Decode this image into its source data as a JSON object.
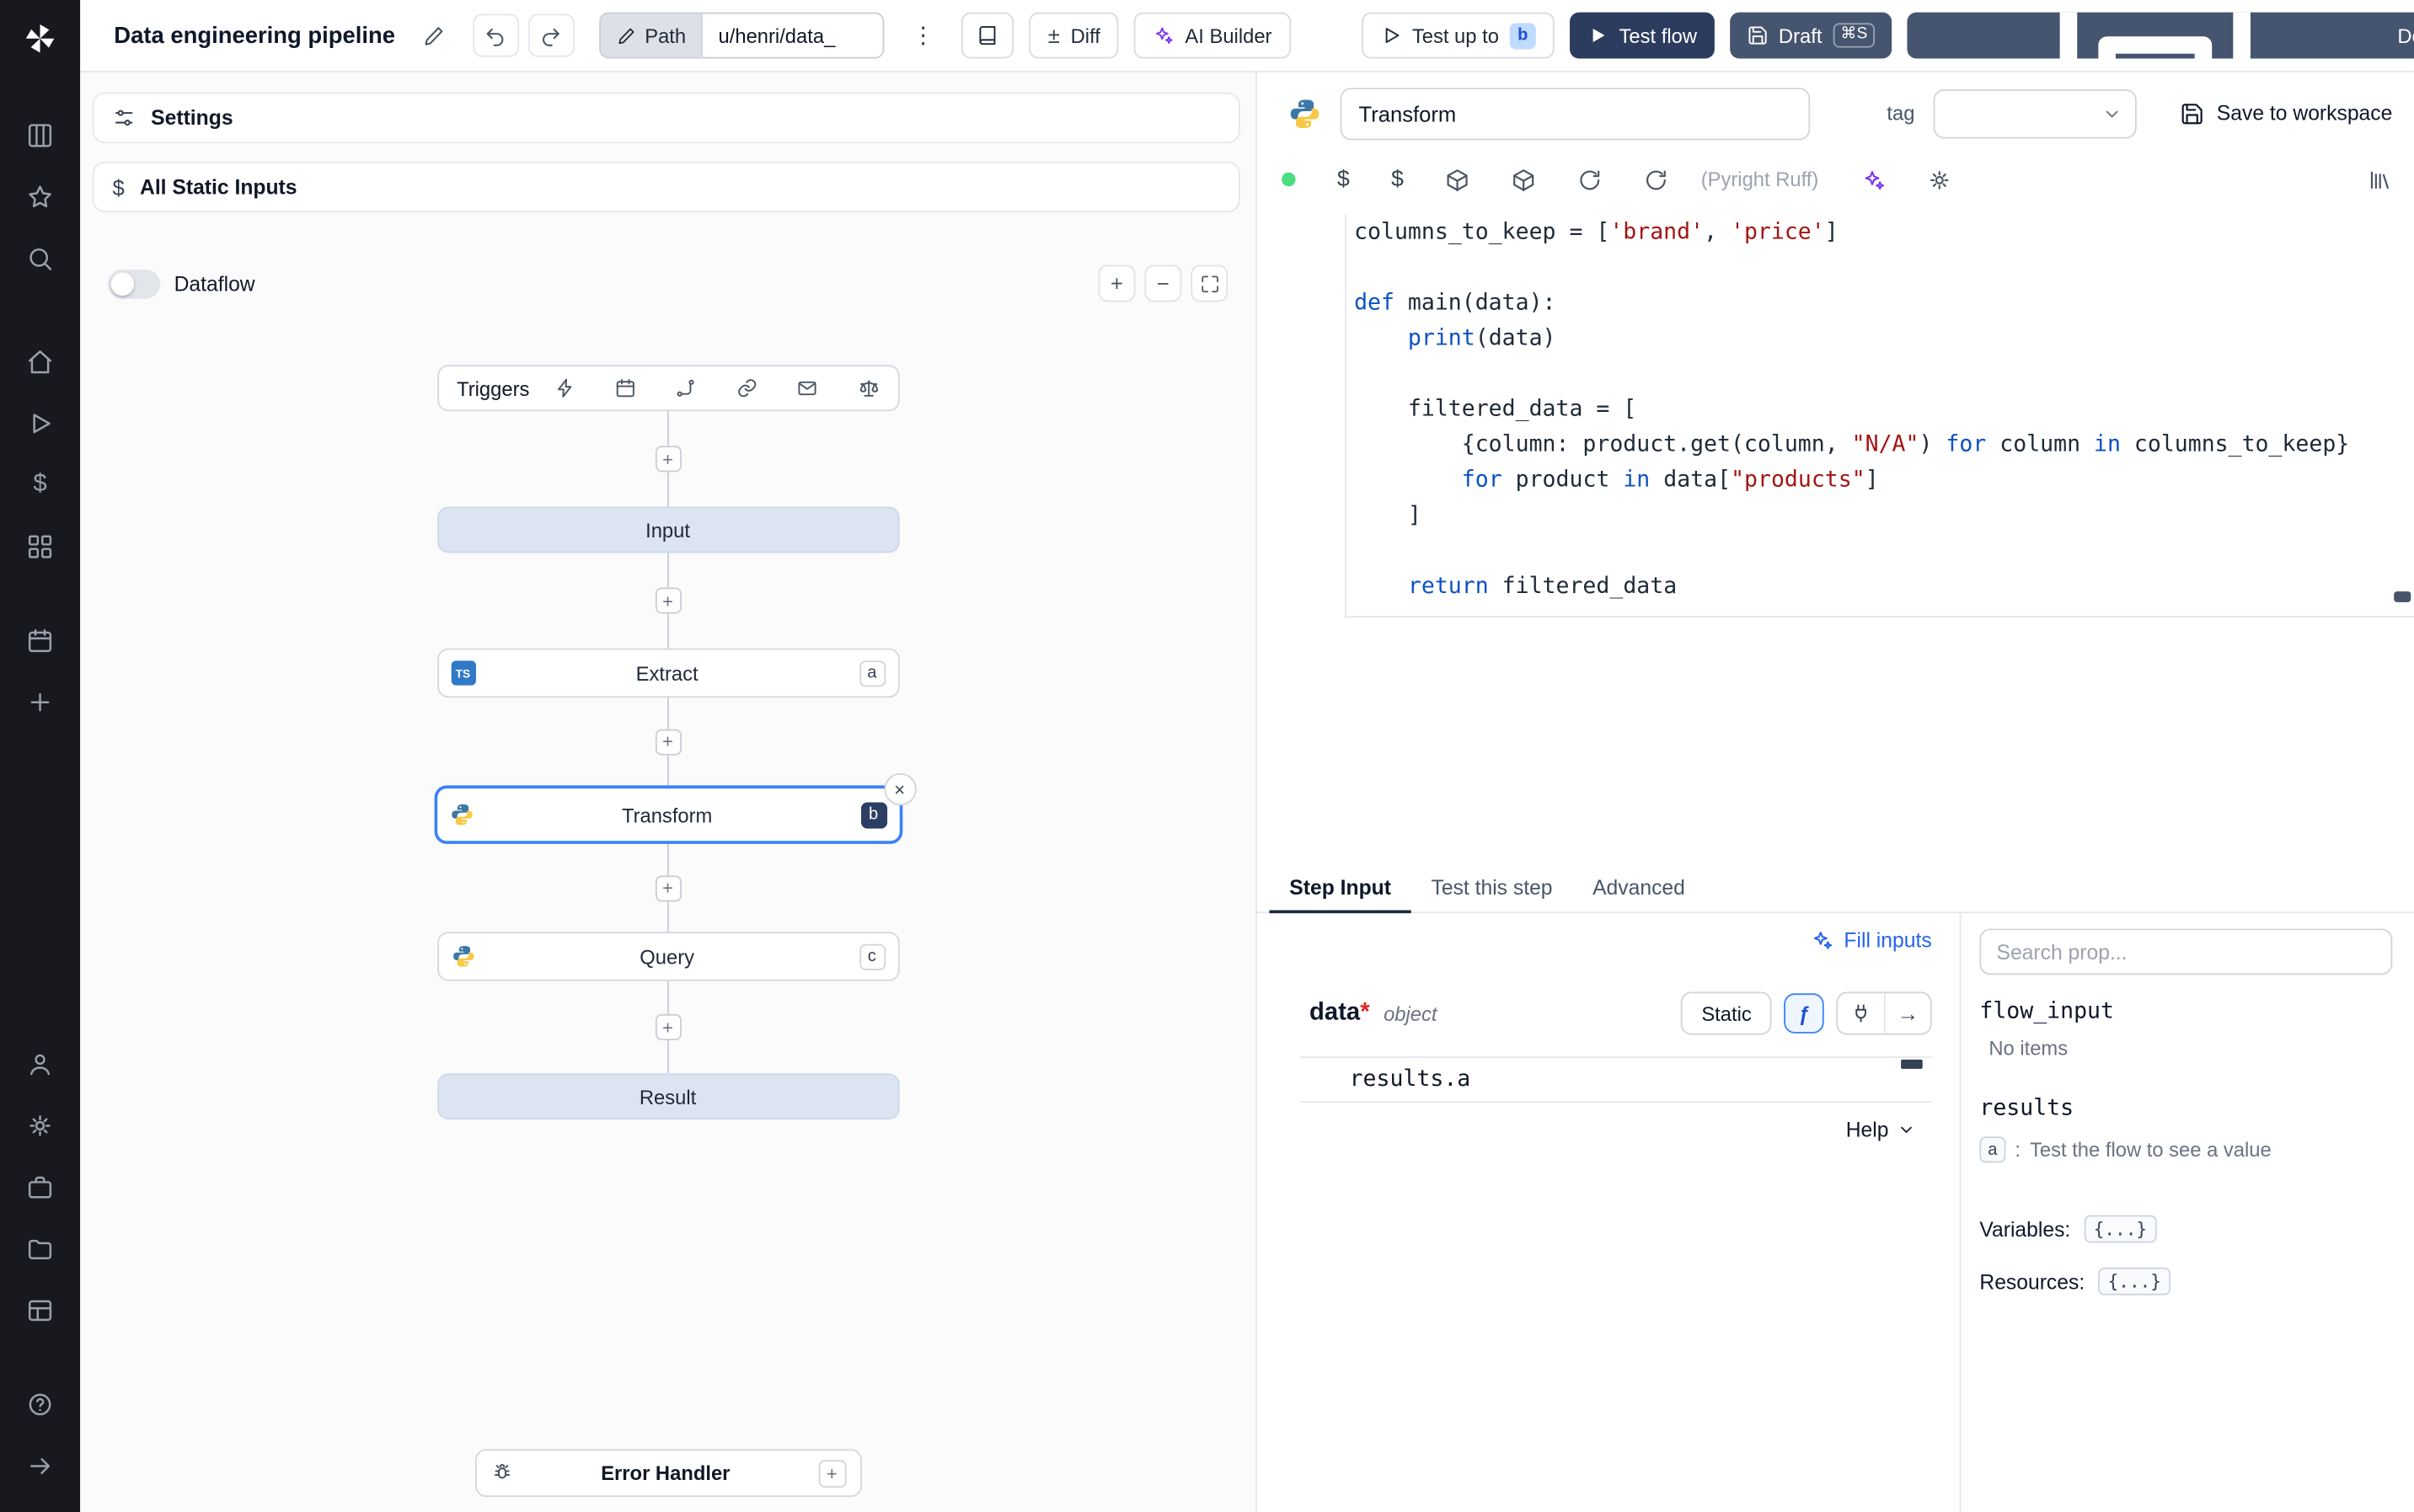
{
  "icons": {
    "kebab": "⋮",
    "plus": "+",
    "minus": "−",
    "close": "×",
    "dollar": "$",
    "fx": "ƒ",
    "plus_minus": "±",
    "ts": "TS",
    "arrow": "→"
  },
  "header": {
    "title": "Data engineering pipeline",
    "path": {
      "label": "Path",
      "value": "u/henri/data_"
    },
    "diff": "Diff",
    "ai_builder": "AI Builder",
    "test_up_to": {
      "label": "Test up to",
      "badge": "b"
    },
    "test_flow": "Test flow",
    "draft": {
      "label": "Draft",
      "shortcut": "⌘S"
    },
    "deploy": "Deploy"
  },
  "flow_panel": {
    "settings": "Settings",
    "all_static_inputs": "All Static Inputs",
    "dataflow": "Dataflow",
    "triggers": "Triggers",
    "nodes": {
      "input": "Input",
      "extract": {
        "label": "Extract",
        "badge": "a"
      },
      "transform": {
        "label": "Transform",
        "badge": "b"
      },
      "query": {
        "label": "Query",
        "badge": "c"
      },
      "result": "Result"
    },
    "error_handler": "Error Handler"
  },
  "editor": {
    "step_name": "Transform",
    "tag_label": "tag",
    "save_to_workspace": "Save to workspace",
    "lint": "(Pyright Ruff)",
    "code_lines": [
      [
        {
          "t": "columns_to_keep = [",
          "c": "d"
        },
        {
          "t": "'brand'",
          "c": "s"
        },
        {
          "t": ", ",
          "c": "d"
        },
        {
          "t": "'price'",
          "c": "s"
        },
        {
          "t": "]",
          "c": "d"
        }
      ],
      [],
      [
        {
          "t": "def ",
          "c": "k"
        },
        {
          "t": "main(data):",
          "c": "d"
        }
      ],
      [
        {
          "t": "    ",
          "c": "d"
        },
        {
          "t": "print",
          "c": "k"
        },
        {
          "t": "(data)",
          "c": "d"
        }
      ],
      [],
      [
        {
          "t": "    filtered_data = [",
          "c": "d"
        }
      ],
      [
        {
          "t": "        {column: product.get(column, ",
          "c": "d"
        },
        {
          "t": "\"N/A\"",
          "c": "s"
        },
        {
          "t": ") ",
          "c": "d"
        },
        {
          "t": "for",
          "c": "k"
        },
        {
          "t": " column ",
          "c": "d"
        },
        {
          "t": "in",
          "c": "k"
        },
        {
          "t": " columns_to_keep}",
          "c": "d"
        }
      ],
      [
        {
          "t": "        ",
          "c": "d"
        },
        {
          "t": "for",
          "c": "k"
        },
        {
          "t": " product ",
          "c": "d"
        },
        {
          "t": "in",
          "c": "k"
        },
        {
          "t": " data[",
          "c": "d"
        },
        {
          "t": "\"products\"",
          "c": "s"
        },
        {
          "t": "]",
          "c": "d"
        }
      ],
      [
        {
          "t": "    ]",
          "c": "d"
        }
      ],
      [],
      [
        {
          "t": "    ",
          "c": "d"
        },
        {
          "t": "return",
          "c": "k"
        },
        {
          "t": " filtered_data",
          "c": "d"
        }
      ]
    ]
  },
  "step_panel": {
    "tabs": [
      "Step Input",
      "Test this step",
      "Advanced"
    ],
    "fill_inputs": "Fill inputs",
    "field": {
      "name": "data",
      "required_mark": "*",
      "type": "object"
    },
    "static_label": "Static",
    "expression": "results.a",
    "help": "Help"
  },
  "props_panel": {
    "search_placeholder": "Search prop...",
    "flow_input": "flow_input",
    "no_items": "No items",
    "results": "results",
    "result_item": {
      "key": "a",
      "separator": ":",
      "hint": "Test the flow to see a value"
    },
    "variables": {
      "label": "Variables:",
      "value": "{...}"
    },
    "resources": {
      "label": "Resources:",
      "value": "{...}"
    }
  }
}
